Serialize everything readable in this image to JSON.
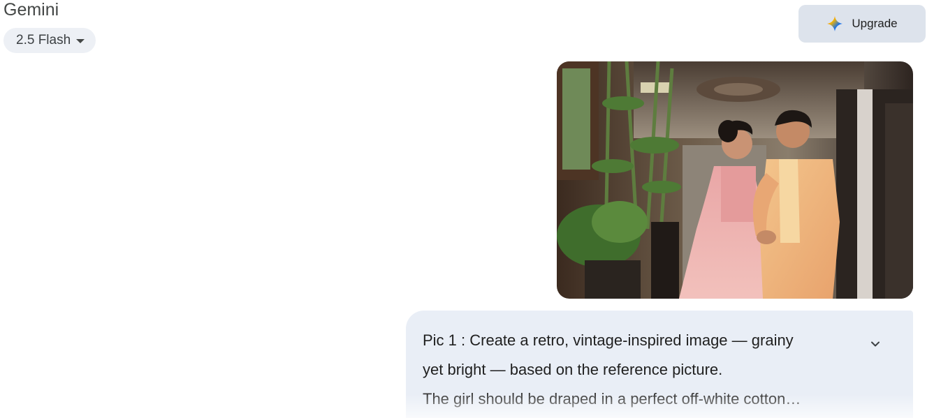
{
  "header": {
    "title": "Gemini",
    "model_label": "2.5 Flash",
    "upgrade_label": "Upgrade"
  },
  "message": {
    "lines": [
      "Pic 1 : Create a retro, vintage-inspired image — grainy",
      "yet bright — based on the reference picture.",
      "The girl should be draped in a perfect off-white cotton…"
    ],
    "expand_icon": "chevron-down-icon"
  },
  "icons": {
    "upgrade": "sparkle-icon",
    "model_menu": "caret-down-icon"
  },
  "colors": {
    "bubble_bg": "#e9eef6",
    "upgrade_bg": "#dde3ec",
    "chip_bg": "#edf0f5"
  }
}
